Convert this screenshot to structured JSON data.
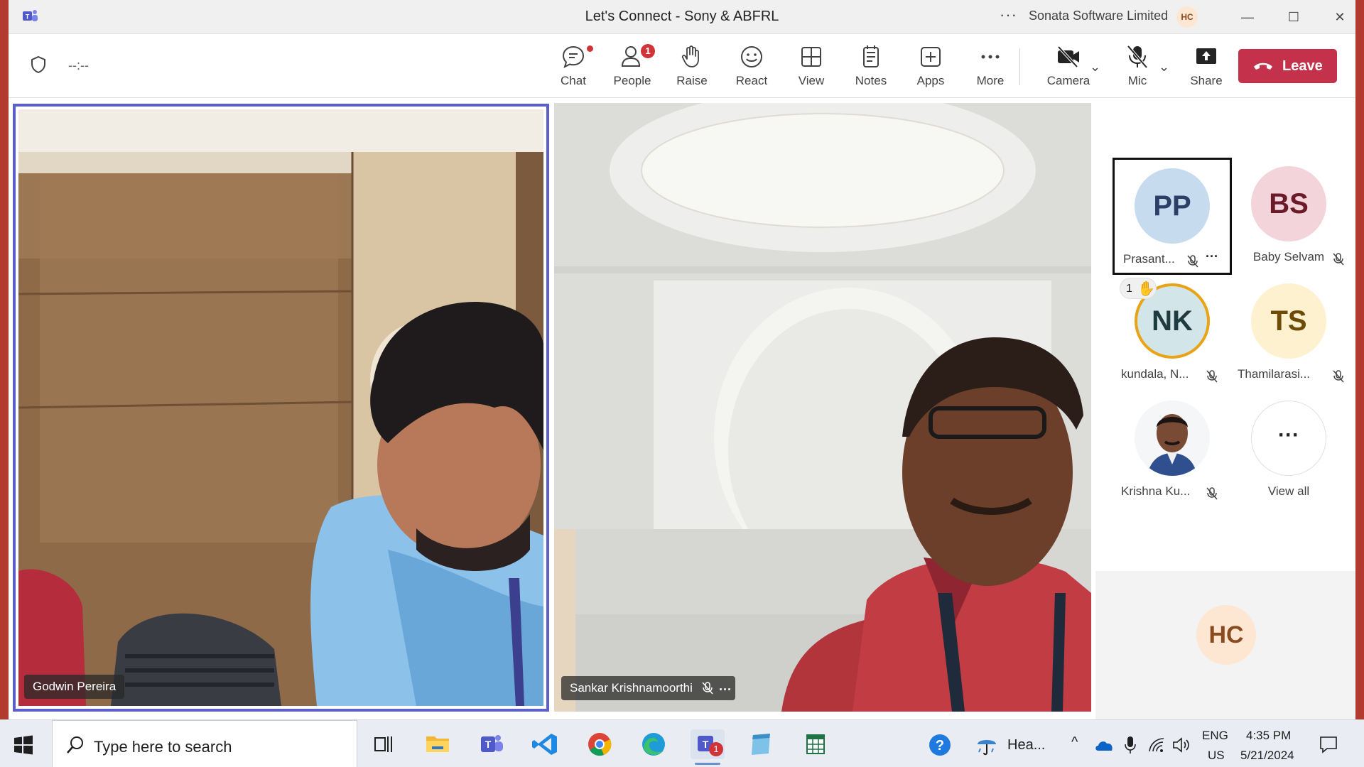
{
  "window": {
    "title": "Let's Connect - Sony & ABFRL",
    "more_label": "···",
    "org_name": "Sonata Software Limited",
    "user_initials": "HC",
    "minimize_label": "—",
    "maximize_label": "☐",
    "close_label": "✕"
  },
  "toolbar": {
    "timer": "--:--",
    "chat": "Chat",
    "people": "People",
    "people_badge": "1",
    "raise": "Raise",
    "react": "React",
    "view": "View",
    "notes": "Notes",
    "apps": "Apps",
    "more": "More",
    "camera": "Camera",
    "mic": "Mic",
    "share": "Share",
    "leave": "Leave"
  },
  "videos": {
    "main_left_name": "Godwin Pereira",
    "main_right_name": "Sankar Krishnamoorthi"
  },
  "roster": {
    "participants": [
      {
        "initials": "PP",
        "name": "Prasant...",
        "muted": true,
        "avatar_bg": "#c7dbef",
        "avatar_fg": "#2d3f66"
      },
      {
        "initials": "BS",
        "name": "Baby Selvam",
        "muted": true,
        "avatar_bg": "#f2d4da",
        "avatar_fg": "#6b1a2a"
      },
      {
        "initials": "NK",
        "name": "kundala, N...",
        "muted": true,
        "avatar_bg": "#d2e6ea",
        "avatar_fg": "#1f3b40",
        "hand_raised": true,
        "hand_order": "1"
      },
      {
        "initials": "TS",
        "name": "Thamilarasi...",
        "muted": true,
        "avatar_bg": "#fdf1cf",
        "avatar_fg": "#6e4b06"
      },
      {
        "initials": "",
        "name": "Krishna Ku...",
        "muted": true,
        "has_photo": true
      }
    ],
    "view_all_label": "View all",
    "view_all_glyph": "···",
    "self_initials": "HC"
  },
  "taskbar": {
    "search_placeholder": "Type here to search",
    "weather_label": "Hea...",
    "lang_primary": "ENG",
    "lang_secondary": "US",
    "time": "4:35 PM",
    "date": "5/21/2024",
    "teams_badge": "1"
  }
}
